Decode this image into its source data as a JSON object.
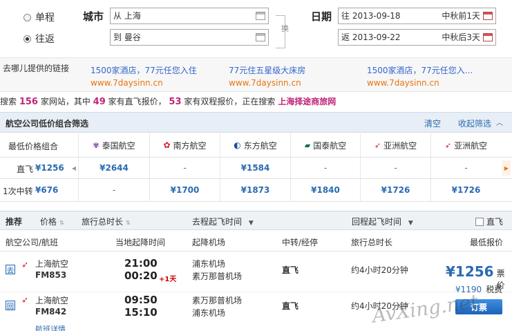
{
  "search": {
    "trip_oneway": "单程",
    "trip_round": "往返",
    "city_label": "城市",
    "date_label": "日期",
    "from_value": "从 上海",
    "to_value": "到 曼谷",
    "swap": "换",
    "depart_value": "往 2013-09-18",
    "return_value": "返 2013-09-22",
    "depart_hint": "中秋前1天",
    "return_hint": "中秋后3天"
  },
  "ads": {
    "header": "去哪儿提供的链接",
    "items": [
      {
        "title": "1500家酒店，77元任您入住",
        "url": "www.7daysinn.cn"
      },
      {
        "title": "77元住五星级大床房",
        "url": "www.7daysinn.cn"
      },
      {
        "title": "1500家酒店，77元任您入...",
        "url": "www.7daysinn.cn"
      }
    ]
  },
  "stats": {
    "p1": "搜索",
    "n1": "156",
    "p2": "家网站，其中",
    "n2": "49",
    "p3": "家有直飞报价，",
    "n3": "53",
    "p4": "家有双程报价，正在搜索",
    "site": "上海择途商旅网"
  },
  "filter": {
    "title": "航空公司低价组合筛选",
    "clear": "清空",
    "collapse": "收起筛选",
    "row0_label": "最低价格组合",
    "row1_label": "直飞",
    "row1_best": "¥1256",
    "row2_label": "1次中转",
    "row2_best": "¥676",
    "airlines": [
      {
        "name": "泰国航空",
        "direct": "¥2644",
        "transfer": "-"
      },
      {
        "name": "南方航空",
        "direct": "-",
        "transfer": "¥1700"
      },
      {
        "name": "东方航空",
        "direct": "¥1584",
        "transfer": "¥1873"
      },
      {
        "name": "国泰航空",
        "direct": "-",
        "transfer": "¥1840"
      },
      {
        "name": "亚洲航空",
        "direct": "-",
        "transfer": "¥1726"
      },
      {
        "name": "亚洲航空",
        "direct": "-",
        "transfer": "¥1726"
      }
    ]
  },
  "sort": {
    "recommend": "推荐",
    "price": "价格",
    "duration": "旅行总时长",
    "depart_time": "去程起飞时间",
    "return_time": "回程起飞时间",
    "direct": "直飞"
  },
  "columns": {
    "airline": "航空公司/航班",
    "local_time": "当地起降时间",
    "airport": "起降机场",
    "stop": "中转/经停",
    "total": "旅行总时长",
    "lowest": "最低报价"
  },
  "flights": [
    {
      "badge": "去",
      "airline": "上海航空",
      "no": "FM853",
      "dep": "21:00",
      "arr": "00:20",
      "plus": "+1天",
      "ap1": "浦东机场",
      "ap2": "素万那普机场",
      "stop": "直飞",
      "total": "约4小时20分钟"
    },
    {
      "badge": "回",
      "airline": "上海航空",
      "no": "FM842",
      "dep": "09:50",
      "arr": "15:10",
      "plus": "",
      "ap1": "素万那普机场",
      "ap2": "浦东机场",
      "stop": "直飞",
      "total": "约4小时20分钟"
    }
  ],
  "offer": {
    "price": "¥1256",
    "price_label": "票价",
    "tax": "¥1190",
    "tax_label": "税费",
    "book": "订票",
    "detail": "航班详情"
  },
  "watermark": "AvXing.net",
  "colors": {
    "accent": "#2b6ab2",
    "highlight": "#c0247a",
    "ad_url": "#e8740f"
  }
}
